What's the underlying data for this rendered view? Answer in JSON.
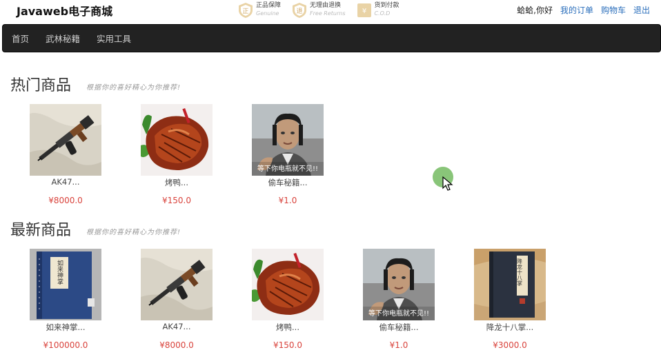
{
  "header": {
    "logo": "Javaweb电子商城",
    "badges": [
      {
        "cn": "正品保障",
        "en": "Genuine",
        "icon": "genuine-icon"
      },
      {
        "cn": "无理由退换",
        "en": "Free Returns",
        "icon": "returns-icon"
      },
      {
        "cn": "货到付款",
        "en": "C.O.D",
        "icon": "cod-icon"
      }
    ],
    "greeting": "蛤蛤,你好",
    "links": [
      "我的订单",
      "购物车",
      "退出"
    ]
  },
  "nav": [
    "首页",
    "武林秘籍",
    "实用工具"
  ],
  "hot": {
    "title": "热门商品",
    "slogan": "根据你的喜好精心为你推荐!",
    "products": [
      {
        "name": "AK47...",
        "price": "¥8000.0",
        "image": "rifle"
      },
      {
        "name": "烤鸭...",
        "price": "¥150.0",
        "image": "roast-duck"
      },
      {
        "name": "偷车秘籍...",
        "price": "¥1.0",
        "image": "man-pointing"
      }
    ]
  },
  "new": {
    "title": "最新商品",
    "slogan": "根据你的喜好精心为你推荐!",
    "products": [
      {
        "name": "如来神掌...",
        "price": "¥100000.0",
        "image": "book-blue"
      },
      {
        "name": "AK47...",
        "price": "¥8000.0",
        "image": "rifle"
      },
      {
        "name": "烤鸭...",
        "price": "¥150.0",
        "image": "roast-duck"
      },
      {
        "name": "偷车秘籍...",
        "price": "¥1.0",
        "image": "man-pointing"
      },
      {
        "name": "降龙十八掌...",
        "price": "¥3000.0",
        "image": "book-dark"
      }
    ]
  },
  "image_captions": {
    "book_blue": "如来神掌",
    "book_dark": "降龙十八掌",
    "meme": "等下你电瓶就不见!!"
  },
  "colors": {
    "price": "#d9433c",
    "link": "#2a6ebb",
    "navbar": "#222222"
  }
}
